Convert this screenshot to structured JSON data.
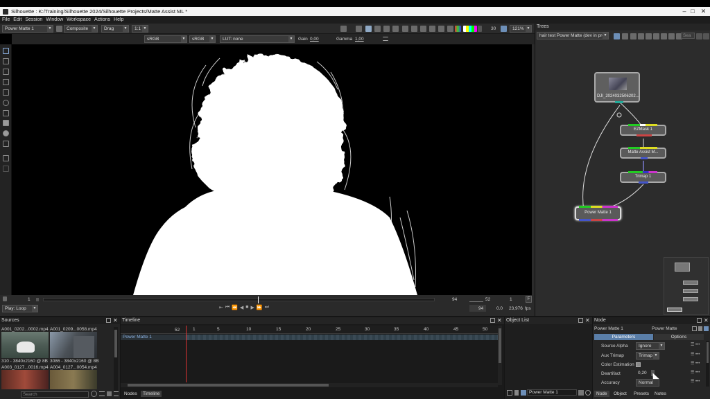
{
  "window": {
    "title": "Silhouette : K:/Training/Silhouette 2024/Silhouette Projects/Matte Assist ML *",
    "controls": [
      "–",
      "□",
      "✕"
    ]
  },
  "menu": [
    "File",
    "Edit",
    "Session",
    "Window",
    "Workspace",
    "Actions",
    "Help"
  ],
  "toolbar": {
    "node_select": "Power Matte 1",
    "view_mode": "Composite",
    "drag_mode": "Drag",
    "ratio": "1:1",
    "frame_value": "30",
    "zoom": "121%"
  },
  "viewer_bar": {
    "color_in": "sRGB",
    "color_out": "sRGB",
    "lut": "LUT: none",
    "gain_label": "Gain",
    "gain_value": "0,00",
    "gamma_label": "Gamma",
    "gamma_value": "1,00"
  },
  "playback": {
    "start_frame": "1",
    "end_frame": "94",
    "current_frame": "52",
    "step": "1",
    "f_button": "F",
    "play_mode": "Play: Loop",
    "duration": "94",
    "offset": "0.0",
    "fps_value": "23,976",
    "fps_label": "fps"
  },
  "trees": {
    "title": "Trees",
    "tree_select": "hair test Power Matte (dev in prog",
    "search_placeholder": "Sea",
    "nodes": {
      "source": "DJI_2024032506202...",
      "ezmask": "EZMask 1",
      "matte_assist": "Matte Assist M...",
      "trimap": "Trimap 1",
      "power_matte": "Power Matte 1"
    }
  },
  "sources": {
    "title": "Sources",
    "items": [
      {
        "name": "A001_0202...0002.mp4",
        "info": "310 - 3840x2160 @ 8B"
      },
      {
        "name": "A001_0209...0058.mp4",
        "info": "3086 - 3840x2160 @ 8B"
      },
      {
        "name": "A003_0127...0016.mp4",
        "info": ""
      },
      {
        "name": "A004_0127...0054.mp4",
        "info": ""
      }
    ],
    "search_placeholder": "Search"
  },
  "timeline": {
    "title": "Timeline",
    "current": "52",
    "ticks": [
      "1",
      "5",
      "10",
      "15",
      "20",
      "25",
      "30",
      "35",
      "40",
      "45",
      "50"
    ],
    "track_name": "Power Matte 1",
    "tabs": [
      "Nodes",
      "Timeline"
    ]
  },
  "object_list": {
    "title": "Object List",
    "item": "Power Matte 1"
  },
  "node_panel": {
    "title": "Node",
    "node_name": "Power Matte 1",
    "node_type": "Power Matte",
    "tab_parameters": "Parameters",
    "tab_options": "Options",
    "params": [
      {
        "label": "Source Alpha",
        "value": "Ignore"
      },
      {
        "label": "Aux Trimap",
        "value": "Trimap"
      },
      {
        "label": "Color Estimation",
        "value": ""
      },
      {
        "label": "Deartifact",
        "value": "0,20"
      },
      {
        "label": "Accuracy",
        "value": "Normal"
      }
    ],
    "bottom_tabs": [
      "Node",
      "Object",
      "Presets",
      "Notes"
    ]
  }
}
